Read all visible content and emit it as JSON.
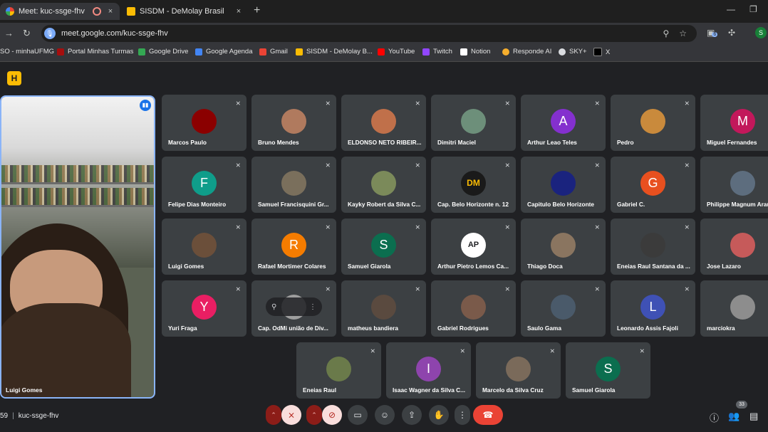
{
  "browser": {
    "tabs": [
      {
        "title": "Meet: kuc-ssge-fhv",
        "close": "×"
      },
      {
        "title": "SISDM - DeMolay Brasil",
        "close": "×"
      }
    ],
    "new_tab": "+",
    "window_controls": {
      "minimize": "—",
      "restore": "❐"
    },
    "nav": {
      "back": "→",
      "reload": "↻"
    },
    "url": "meet.google.com/kuc-ssge-fhv",
    "profile_initial": "S",
    "extension_badge": "6",
    "bookmarks": [
      {
        "label": "SO - minhaUFMG",
        "color": "#9aa0a6"
      },
      {
        "label": "Portal Minhas Turmas",
        "color": "#a50e0e"
      },
      {
        "label": "Google Drive",
        "color": "#34a853"
      },
      {
        "label": "Google Agenda",
        "color": "#4285f4"
      },
      {
        "label": "Gmail",
        "color": "#ea4335"
      },
      {
        "label": "SISDM - DeMolay B...",
        "color": "#fbbc04"
      },
      {
        "label": "YouTube",
        "color": "#ff0000"
      },
      {
        "label": "Twitch",
        "color": "#9146ff"
      },
      {
        "label": "Notion",
        "color": "#ffffff"
      },
      {
        "label": "Responde AI",
        "color": "#f6ae2d"
      },
      {
        "label": "SKY+",
        "color": "#dadce0"
      },
      {
        "label": "X",
        "color": "#000000"
      }
    ]
  },
  "meet": {
    "logo": "H",
    "speaker": {
      "name": "Luigi Gomes"
    },
    "participants": [
      {
        "name": "Marcos Paulo",
        "initial": "",
        "color": "#8b0000"
      },
      {
        "name": "Bruno Mendes",
        "initial": "",
        "color": "#b07a5e"
      },
      {
        "name": "ELDONSO NETO RIBEIR...",
        "initial": "",
        "color": "#c0704a"
      },
      {
        "name": "Dimitri Maciel",
        "initial": "",
        "color": "#6d8f7a"
      },
      {
        "name": "Arthur Leao Teles",
        "initial": "A",
        "color": "#8430ce"
      },
      {
        "name": "Pedro",
        "initial": "",
        "color": "#c98a3c"
      },
      {
        "name": "Miguel Fernandes",
        "initial": "M",
        "color": "#c2185b"
      },
      {
        "name": "Felipe Dias Monteiro",
        "initial": "F",
        "color": "#0f9d8a"
      },
      {
        "name": "Samuel Francisquini Gr...",
        "initial": "",
        "color": "#7a6f5c"
      },
      {
        "name": "Kayky Robert da Silva C...",
        "initial": "",
        "color": "#7b8a5a"
      },
      {
        "name": "Cap. Belo Horizonte n. 12",
        "initial": "DM",
        "color": "#1a1a1a"
      },
      {
        "name": "Capitulo Belo Horizonte",
        "initial": "",
        "color": "#1a237e"
      },
      {
        "name": "Gabriel C.",
        "initial": "G",
        "color": "#e8501f"
      },
      {
        "name": "Philippe Magnum Araujo",
        "initial": "",
        "color": "#5d6d7e"
      },
      {
        "name": "Luigi Gomes",
        "initial": "",
        "color": "#6b4f3a"
      },
      {
        "name": "Rafael Mortimer Colares",
        "initial": "R",
        "color": "#f57c00"
      },
      {
        "name": "Samuel Giarola",
        "initial": "S",
        "color": "#0b6e4f"
      },
      {
        "name": "Arthur Pietro Lemos Ca...",
        "initial": "AP",
        "color": "#ffffff"
      },
      {
        "name": "Thiago Doca",
        "initial": "",
        "color": "#8a7560"
      },
      {
        "name": "Eneias Raul Santana da ...",
        "initial": "",
        "color": "#3b3b3b"
      },
      {
        "name": "Jose Lazaro",
        "initial": "",
        "color": "#c65a5a"
      },
      {
        "name": "Yuri Fraga",
        "initial": "Y",
        "color": "#e91e63"
      },
      {
        "name": "Cap. OdMi união de Div...",
        "initial": "",
        "color": "#9e9e9e"
      },
      {
        "name": "matheus bandiera",
        "initial": "",
        "color": "#5a4a3f"
      },
      {
        "name": "Gabriel Rodrigues",
        "initial": "",
        "color": "#7a5a4a"
      },
      {
        "name": "Saulo Gama",
        "initial": "",
        "color": "#4a5a6a"
      },
      {
        "name": "Leonardo Assis Fajoli",
        "initial": "L",
        "color": "#3f51b5"
      },
      {
        "name": "marciokra",
        "initial": "",
        "color": "#8d8d8d"
      },
      {
        "name": "Eneias Raul",
        "initial": "",
        "color": "#6a7a4a"
      },
      {
        "name": "Isaac Wagner da Silva C...",
        "initial": "I",
        "color": "#8e44ad"
      },
      {
        "name": "Marcelo da Silva Cruz",
        "initial": "",
        "color": "#7a6a5a"
      },
      {
        "name": "Samuel Giarola",
        "initial": "S",
        "color": "#0b6e4f"
      }
    ],
    "bottom": {
      "time": "59",
      "code": "kuc-ssge-fhv",
      "participant_count": "33"
    }
  },
  "icons": {
    "mic_off": "⨯",
    "pin": "⚲",
    "more": "⋮",
    "up": "⌃",
    "cam_off": "⊘",
    "captions": "▭",
    "emoji": "☺",
    "present": "⇪",
    "hand": "✋",
    "hangup": "☎",
    "info": "ⓘ",
    "people": "👥",
    "chat": "▤",
    "star": "☆",
    "search": "⚲",
    "speaking": "▮▮"
  }
}
